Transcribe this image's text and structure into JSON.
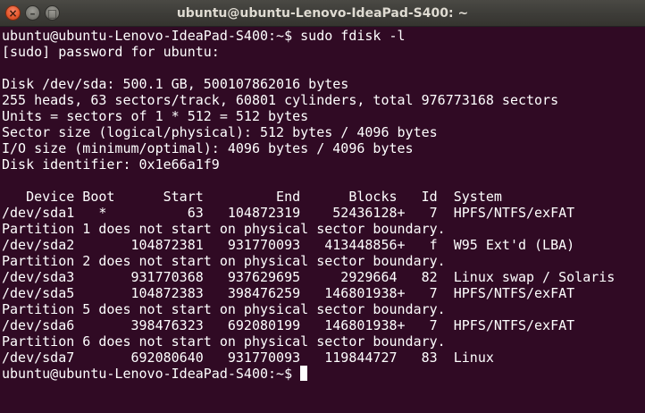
{
  "window": {
    "title": "ubuntu@ubuntu-Lenovo-IdeaPad-S400: ~",
    "close_symbol": "×",
    "minimize_symbol": "–",
    "maximize_symbol": "□"
  },
  "colors": {
    "terminal_background": "#300a24",
    "terminal_text": "#ffffff",
    "close_button": "#e65a2f"
  },
  "terminal": {
    "lines": [
      "ubuntu@ubuntu-Lenovo-IdeaPad-S400:~$ sudo fdisk -l",
      "[sudo] password for ubuntu:",
      "",
      "Disk /dev/sda: 500.1 GB, 500107862016 bytes",
      "255 heads, 63 sectors/track, 60801 cylinders, total 976773168 sectors",
      "Units = sectors of 1 * 512 = 512 bytes",
      "Sector size (logical/physical): 512 bytes / 4096 bytes",
      "I/O size (minimum/optimal): 4096 bytes / 4096 bytes",
      "Disk identifier: 0x1e66a1f9",
      "",
      "   Device Boot      Start         End      Blocks   Id  System",
      "/dev/sda1   *          63   104872319    52436128+   7  HPFS/NTFS/exFAT",
      "Partition 1 does not start on physical sector boundary.",
      "/dev/sda2       104872381   931770093   413448856+   f  W95 Ext'd (LBA)",
      "Partition 2 does not start on physical sector boundary.",
      "/dev/sda3       931770368   937629695     2929664   82  Linux swap / Solaris",
      "/dev/sda5       104872383   398476259   146801938+   7  HPFS/NTFS/exFAT",
      "Partition 5 does not start on physical sector boundary.",
      "/dev/sda6       398476323   692080199   146801938+   7  HPFS/NTFS/exFAT",
      "Partition 6 does not start on physical sector boundary.",
      "/dev/sda7       692080640   931770093   119844727   83  Linux"
    ],
    "prompt": "ubuntu@ubuntu-Lenovo-IdeaPad-S400:~$ "
  }
}
